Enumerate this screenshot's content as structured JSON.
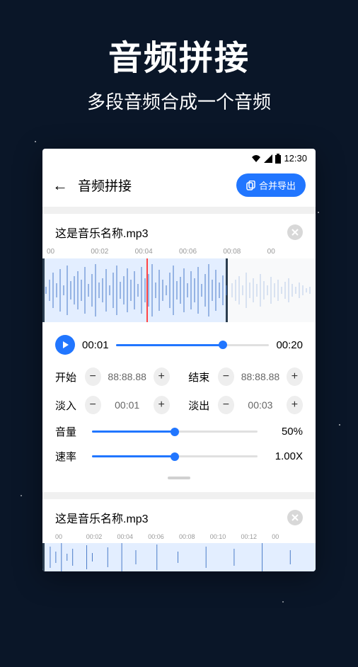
{
  "promo": {
    "title": "音频拼接",
    "subtitle": "多段音频合成一个音频"
  },
  "statusBar": {
    "time": "12:30"
  },
  "appBar": {
    "title": "音频拼接",
    "exportLabel": "合并导出"
  },
  "track1": {
    "filename": "这是音乐名称.mp3",
    "ruler": [
      "00",
      "00:02",
      "00:04",
      "00:06",
      "00:08",
      "00"
    ],
    "playback": {
      "current": "00:01",
      "total": "00:20"
    },
    "start": {
      "label": "开始",
      "value": "88:88.88"
    },
    "end": {
      "label": "结束",
      "value": "88:88.88"
    },
    "fadeIn": {
      "label": "淡入",
      "value": "00:01"
    },
    "fadeOut": {
      "label": "淡出",
      "value": "00:03"
    },
    "volume": {
      "label": "音量",
      "value": "50%"
    },
    "speed": {
      "label": "速率",
      "value": "1.00X"
    }
  },
  "track2": {
    "filename": "这是音乐名称.mp3",
    "ruler": [
      "00",
      "00:02",
      "00:04",
      "00:06",
      "00:08",
      "00:10",
      "00:12",
      "00"
    ]
  }
}
